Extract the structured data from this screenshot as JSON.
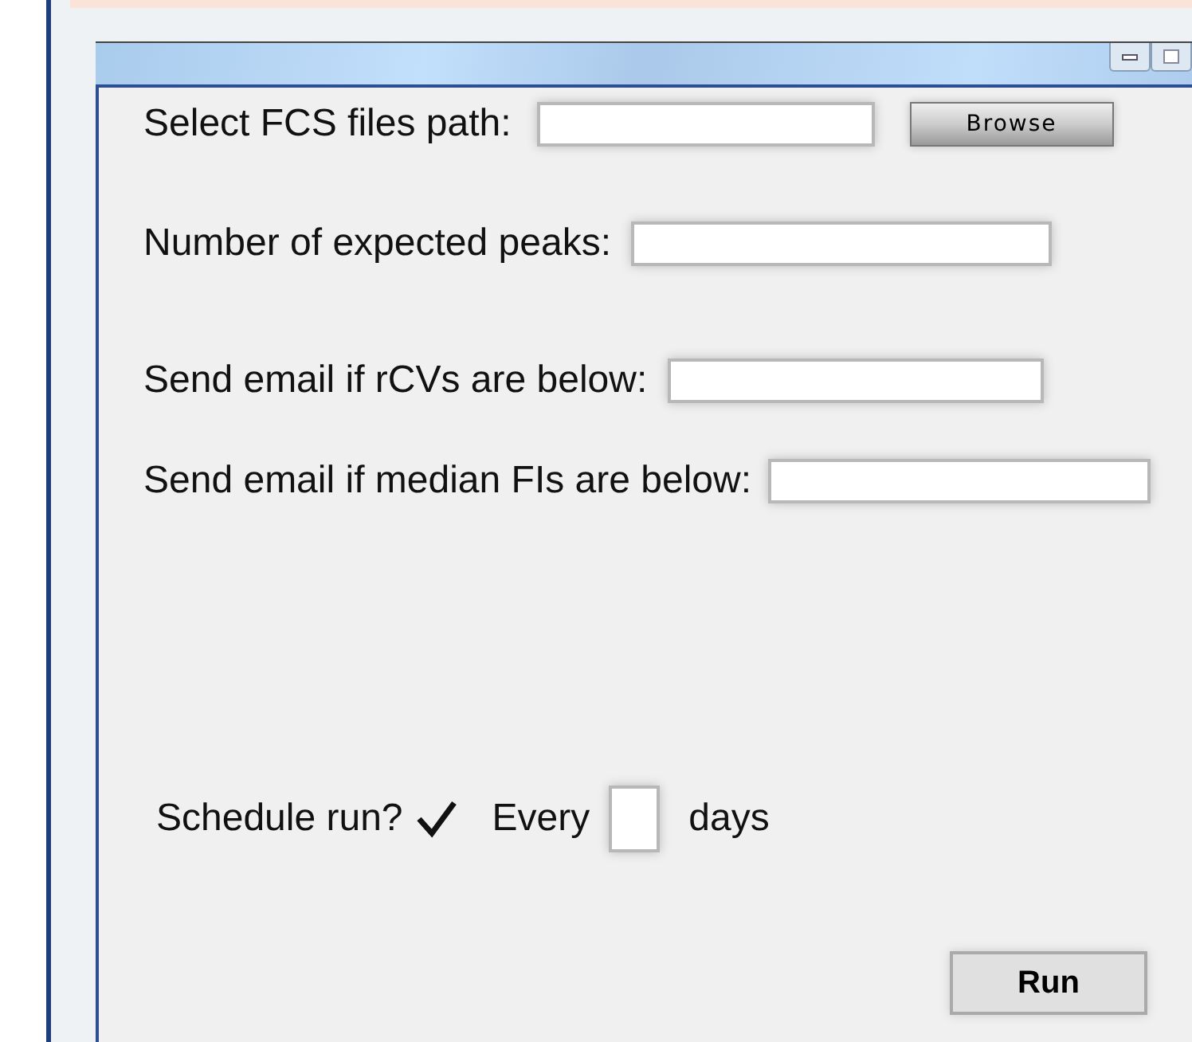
{
  "window": {
    "controls": [
      {
        "kind": "minimize"
      },
      {
        "kind": "maximize"
      }
    ]
  },
  "fields": [
    {
      "label": "Select FCS files path:",
      "button": "Browse"
    },
    {
      "label": "Number of expected peaks:"
    },
    {
      "label": "Send email if rCVs are below:"
    },
    {
      "label": "Send email if median FIs are below:"
    }
  ],
  "schedule": {
    "label": "Schedule run?",
    "checked": true,
    "every": "Every",
    "unit": "days"
  },
  "run_button": "Run"
}
